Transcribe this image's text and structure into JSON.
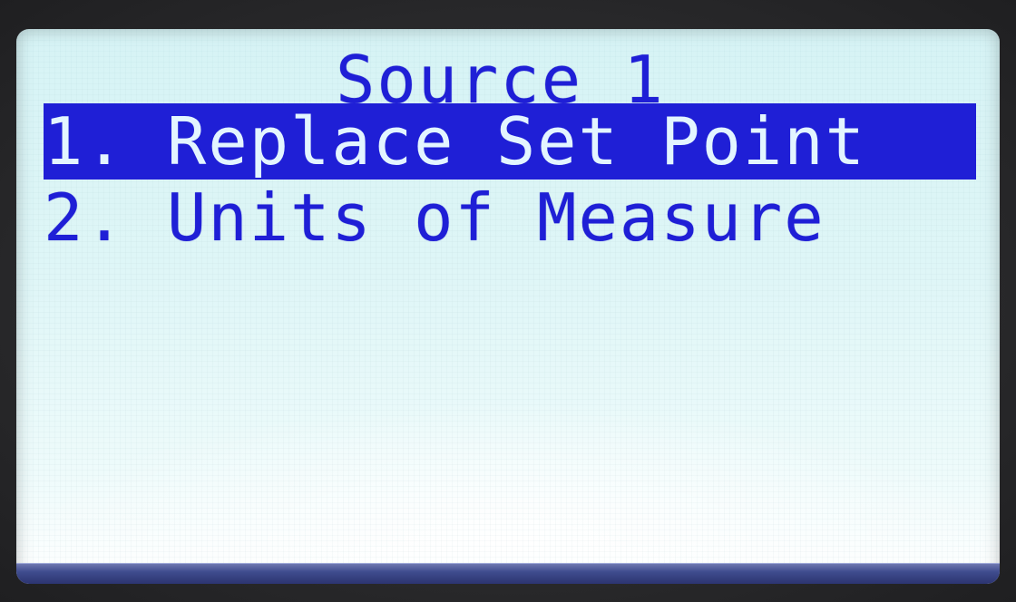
{
  "screen": {
    "title": "Source 1",
    "menu": [
      {
        "label": "1. Replace Set Point",
        "selected": true
      },
      {
        "label": "2. Units of Measure",
        "selected": false
      }
    ]
  },
  "colors": {
    "lcd_text": "#1f1fd6",
    "lcd_background": "#dff6f7",
    "highlight_background": "#1f1fd6",
    "highlight_text": "#e3f5ff"
  }
}
